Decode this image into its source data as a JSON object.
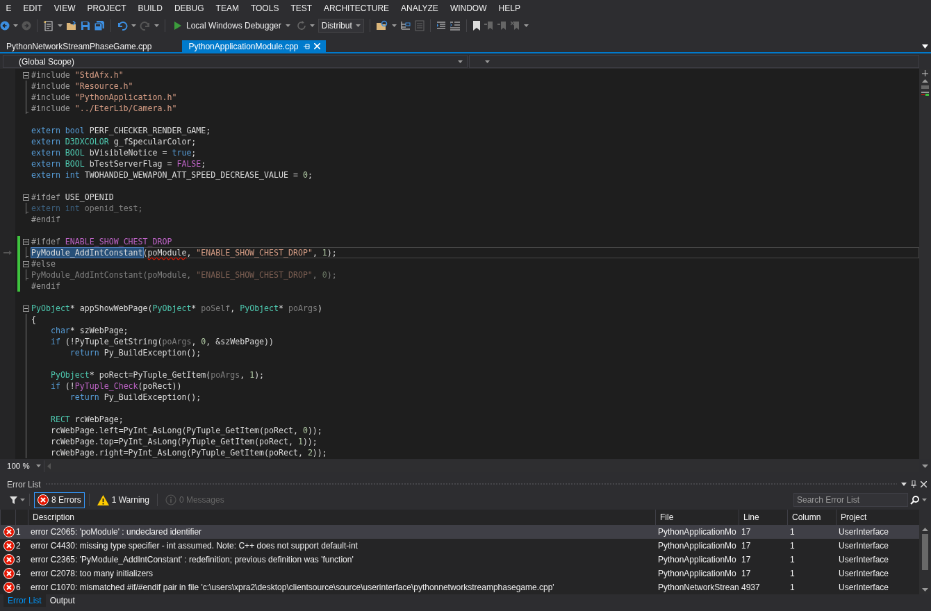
{
  "menu": [
    "E",
    "EDIT",
    "VIEW",
    "PROJECT",
    "BUILD",
    "DEBUG",
    "TEAM",
    "TOOLS",
    "TEST",
    "ARCHITECTURE",
    "ANALYZE",
    "WINDOW",
    "HELP"
  ],
  "toolbar": {
    "debugger": "Local Windows Debugger",
    "configuration": "Distribut"
  },
  "document_tabs": [
    {
      "label": "PythonNetworkStreamPhaseGame.cpp",
      "selected": false
    },
    {
      "label": "PythonApplicationModule.cpp",
      "selected": true
    }
  ],
  "navigation_bar": {
    "scope": "(Global Scope)"
  },
  "editor": {
    "zoom": "100 %",
    "lines": [
      {
        "kind": "fold",
        "changed": false,
        "current": false,
        "inactive": false,
        "tokens": [
          {
            "kind": "pre",
            "text": "#include"
          },
          {
            "kind": "str",
            "text": " \"StdAfx.h\""
          }
        ]
      },
      {
        "kind": "inner",
        "changed": false,
        "current": false,
        "inactive": false,
        "tokens": [
          {
            "kind": "pre",
            "text": "#include"
          },
          {
            "kind": "str",
            "text": " \"Resource.h\""
          }
        ]
      },
      {
        "kind": "inner",
        "changed": false,
        "current": false,
        "inactive": false,
        "tokens": [
          {
            "kind": "pre",
            "text": "#include"
          },
          {
            "kind": "str",
            "text": " \"PythonApplication.h\""
          }
        ]
      },
      {
        "kind": "end",
        "changed": false,
        "current": false,
        "inactive": false,
        "tokens": [
          {
            "kind": "pre",
            "text": "#include"
          },
          {
            "kind": "str",
            "text": " \"../EterLib/Camera.h\""
          }
        ]
      },
      {
        "kind": "none",
        "changed": false,
        "current": false
      },
      {
        "kind": "none",
        "changed": false,
        "current": false,
        "inactive": false,
        "tokens": [
          {
            "kind": "kw",
            "text": "extern"
          },
          {
            "kind": "kw",
            "text": " bool"
          },
          {
            "kind": "plain",
            "text": " PERF_CHECKER_RENDER_GAME;"
          }
        ]
      },
      {
        "kind": "none",
        "changed": false,
        "current": false,
        "inactive": false,
        "tokens": [
          {
            "kind": "kw",
            "text": "extern"
          },
          {
            "kind": "type",
            "text": " D3DXCOLOR"
          },
          {
            "kind": "plain",
            "text": " g_fSpecularColor;"
          }
        ]
      },
      {
        "kind": "none",
        "changed": false,
        "current": false,
        "inactive": false,
        "tokens": [
          {
            "kind": "kw",
            "text": "extern"
          },
          {
            "kind": "type",
            "text": " BOOL"
          },
          {
            "kind": "plain",
            "text": " bVisibleNotice = "
          },
          {
            "kind": "kw",
            "text": "true"
          },
          {
            "kind": "plain",
            "text": ";"
          }
        ]
      },
      {
        "kind": "none",
        "changed": false,
        "current": false,
        "inactive": false,
        "tokens": [
          {
            "kind": "kw",
            "text": "extern"
          },
          {
            "kind": "type",
            "text": " BOOL"
          },
          {
            "kind": "plain",
            "text": " bTestServerFlag = "
          },
          {
            "kind": "macro",
            "text": "FALSE"
          },
          {
            "kind": "plain",
            "text": ";"
          }
        ]
      },
      {
        "kind": "none",
        "changed": false,
        "current": false,
        "inactive": false,
        "tokens": [
          {
            "kind": "kw",
            "text": "extern"
          },
          {
            "kind": "kw",
            "text": " int"
          },
          {
            "kind": "plain",
            "text": " TWOHANDED_WEWAPON_ATT_SPEED_DECREASE_VALUE = "
          },
          {
            "kind": "num",
            "text": "0"
          },
          {
            "kind": "plain",
            "text": ";"
          }
        ]
      },
      {
        "kind": "none",
        "changed": false,
        "current": false
      },
      {
        "kind": "fold",
        "changed": false,
        "current": false,
        "inactive": false,
        "tokens": [
          {
            "kind": "pre",
            "text": "#ifdef"
          },
          {
            "kind": "plain",
            "text": " USE_OPENID"
          }
        ]
      },
      {
        "kind": "end",
        "changed": false,
        "current": false,
        "inactive": true,
        "tokens": [
          {
            "kind": "kw",
            "text": "extern"
          },
          {
            "kind": "kw",
            "text": " int"
          },
          {
            "kind": "plain",
            "text": " openid_test;"
          }
        ]
      },
      {
        "kind": "none",
        "changed": false,
        "current": false,
        "inactive": false,
        "tokens": [
          {
            "kind": "pre",
            "text": "#endif"
          }
        ]
      },
      {
        "kind": "none",
        "changed": false,
        "current": false
      },
      {
        "kind": "fold",
        "changed": true,
        "current": false,
        "inactive": false,
        "tokens": [
          {
            "kind": "pre",
            "text": "#ifdef"
          },
          {
            "kind": "macro",
            "text": " ENABLE_SHOW_CHEST_DROP"
          }
        ]
      },
      {
        "kind": "end",
        "changed": true,
        "current": true,
        "inactive": false,
        "tokens": [
          {
            "kind": "sel",
            "text": "PyModule_AddIntConstant"
          },
          {
            "kind": "plain",
            "text": "("
          },
          {
            "kind": "err",
            "text": "poModule"
          },
          {
            "kind": "plain",
            "text": ", "
          },
          {
            "kind": "str",
            "text": "\"ENABLE_SHOW_CHEST_DROP\""
          },
          {
            "kind": "plain",
            "text": ", "
          },
          {
            "kind": "num",
            "text": "1"
          },
          {
            "kind": "plain",
            "text": ");"
          }
        ]
      },
      {
        "kind": "fold",
        "changed": true,
        "current": false,
        "inactive": false,
        "tokens": [
          {
            "kind": "pre",
            "text": "#else"
          }
        ]
      },
      {
        "kind": "end",
        "changed": true,
        "current": false,
        "inactive": true,
        "tokens": [
          {
            "kind": "plain",
            "text": "PyModule_AddIntConstant(poModule, "
          },
          {
            "kind": "str",
            "text": "\"ENABLE_SHOW_CHEST_DROP\""
          },
          {
            "kind": "plain",
            "text": ", "
          },
          {
            "kind": "num",
            "text": "0"
          },
          {
            "kind": "plain",
            "text": ");"
          }
        ]
      },
      {
        "kind": "none",
        "changed": true,
        "current": false,
        "inactive": false,
        "tokens": [
          {
            "kind": "pre",
            "text": "#endif"
          }
        ]
      },
      {
        "kind": "none",
        "changed": false,
        "current": false
      },
      {
        "kind": "fold",
        "changed": false,
        "current": false,
        "inactive": false,
        "tokens": [
          {
            "kind": "type",
            "text": "PyObject"
          },
          {
            "kind": "plain",
            "text": "* appShowWebPage("
          },
          {
            "kind": "type",
            "text": "PyObject"
          },
          {
            "kind": "plain",
            "text": "* "
          },
          {
            "kind": "param",
            "text": "poSelf"
          },
          {
            "kind": "plain",
            "text": ", "
          },
          {
            "kind": "type",
            "text": "PyObject"
          },
          {
            "kind": "plain",
            "text": "* "
          },
          {
            "kind": "param",
            "text": "poArgs"
          },
          {
            "kind": "plain",
            "text": ")"
          }
        ]
      },
      {
        "kind": "inner",
        "changed": false,
        "current": false,
        "inactive": false,
        "tokens": [
          {
            "kind": "plain",
            "text": "{"
          }
        ]
      },
      {
        "kind": "inner",
        "changed": false,
        "current": false,
        "inactive": false,
        "tokens": [
          {
            "kind": "kw",
            "text": "    char"
          },
          {
            "kind": "plain",
            "text": "* szWebPage;"
          }
        ]
      },
      {
        "kind": "inner",
        "changed": false,
        "current": false,
        "inactive": false,
        "tokens": [
          {
            "kind": "kw",
            "text": "    if"
          },
          {
            "kind": "plain",
            "text": " (!PyTuple_GetString("
          },
          {
            "kind": "param",
            "text": "poArgs"
          },
          {
            "kind": "plain",
            "text": ", "
          },
          {
            "kind": "num",
            "text": "0"
          },
          {
            "kind": "plain",
            "text": ", &szWebPage))"
          }
        ]
      },
      {
        "kind": "inner",
        "changed": false,
        "current": false,
        "inactive": false,
        "tokens": [
          {
            "kind": "kw",
            "text": "        return"
          },
          {
            "kind": "plain",
            "text": " Py_BuildException();"
          }
        ]
      },
      {
        "kind": "inner",
        "changed": false,
        "current": false
      },
      {
        "kind": "inner",
        "changed": false,
        "current": false,
        "inactive": false,
        "tokens": [
          {
            "kind": "type",
            "text": "    PyObject"
          },
          {
            "kind": "plain",
            "text": "* poRect=PyTuple_GetItem("
          },
          {
            "kind": "param",
            "text": "poArgs"
          },
          {
            "kind": "plain",
            "text": ", "
          },
          {
            "kind": "num",
            "text": "1"
          },
          {
            "kind": "plain",
            "text": ");"
          }
        ]
      },
      {
        "kind": "inner",
        "changed": false,
        "current": false,
        "inactive": false,
        "tokens": [
          {
            "kind": "kw",
            "text": "    if"
          },
          {
            "kind": "plain",
            "text": " (!"
          },
          {
            "kind": "macro",
            "text": "PyTuple_Check"
          },
          {
            "kind": "plain",
            "text": "(poRect))"
          }
        ]
      },
      {
        "kind": "inner",
        "changed": false,
        "current": false,
        "inactive": false,
        "tokens": [
          {
            "kind": "kw",
            "text": "        return"
          },
          {
            "kind": "plain",
            "text": " Py_BuildException();"
          }
        ]
      },
      {
        "kind": "inner",
        "changed": false,
        "current": false
      },
      {
        "kind": "inner",
        "changed": false,
        "current": false,
        "inactive": false,
        "tokens": [
          {
            "kind": "type",
            "text": "    RECT"
          },
          {
            "kind": "plain",
            "text": " rcWebPage;"
          }
        ]
      },
      {
        "kind": "inner",
        "changed": false,
        "current": false,
        "inactive": false,
        "tokens": [
          {
            "kind": "plain",
            "text": "    rcWebPage.left=PyInt_AsLong(PyTuple_GetItem(poRect, "
          },
          {
            "kind": "num",
            "text": "0"
          },
          {
            "kind": "plain",
            "text": "));"
          }
        ]
      },
      {
        "kind": "inner",
        "changed": false,
        "current": false,
        "inactive": false,
        "tokens": [
          {
            "kind": "plain",
            "text": "    rcWebPage.top=PyInt_AsLong(PyTuple_GetItem(poRect, "
          },
          {
            "kind": "num",
            "text": "1"
          },
          {
            "kind": "plain",
            "text": "));"
          }
        ]
      },
      {
        "kind": "inner",
        "changed": false,
        "current": false,
        "inactive": false,
        "tokens": [
          {
            "kind": "plain",
            "text": "    rcWebPage.right=PyInt_AsLong(PyTuple_GetItem(poRect, "
          },
          {
            "kind": "num",
            "text": "2"
          },
          {
            "kind": "plain",
            "text": "));"
          }
        ]
      }
    ]
  },
  "error_list": {
    "title": "Error List",
    "filters": [
      {
        "kind": "error",
        "label": "8 Errors",
        "selected": true,
        "disabled": false
      },
      {
        "kind": "warning",
        "label": "1 Warning",
        "selected": false,
        "disabled": false
      },
      {
        "kind": "message",
        "label": "0 Messages",
        "selected": false,
        "disabled": true
      }
    ],
    "search": {
      "placeholder": "Search Error List"
    },
    "columns": [
      "Description",
      "File",
      "Line",
      "Column",
      "Project"
    ],
    "rows": [
      {
        "selected": true,
        "number": "1",
        "description": "error C2065: 'poModule' : undeclared identifier",
        "file": "PythonApplicationMo",
        "line": "17",
        "column": "1",
        "project": "UserInterface"
      },
      {
        "selected": false,
        "number": "2",
        "description": "error C4430: missing type specifier - int assumed. Note: C++ does not support default-int",
        "file": "PythonApplicationMo",
        "line": "17",
        "column": "1",
        "project": "UserInterface"
      },
      {
        "selected": false,
        "number": "3",
        "description": "error C2365: 'PyModule_AddIntConstant' : redefinition; previous definition was 'function'",
        "file": "PythonApplicationMo",
        "line": "17",
        "column": "1",
        "project": "UserInterface"
      },
      {
        "selected": false,
        "number": "4",
        "description": "error C2078: too many initializers",
        "file": "PythonApplicationMo",
        "line": "17",
        "column": "1",
        "project": "UserInterface"
      },
      {
        "selected": false,
        "number": "6",
        "description": "error C1070: mismatched #if/#endif pair in file 'c:\\users\\xpra2\\desktop\\clientsource\\source\\userinterface\\pythonnetworkstreamphasegame.cpp'",
        "file": "PythonNetworkStrean",
        "line": "4937",
        "column": "1",
        "project": "UserInterface"
      }
    ]
  },
  "panel_tabs": [
    {
      "label": "Error List",
      "selected": true
    },
    {
      "label": "Output",
      "selected": false
    }
  ]
}
